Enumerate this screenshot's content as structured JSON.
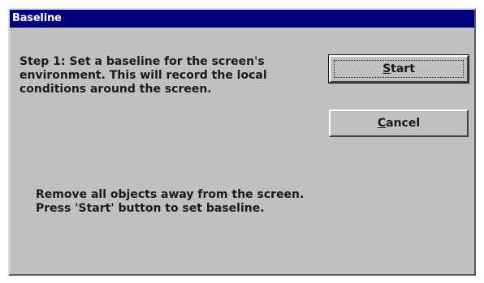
{
  "window": {
    "title": "Baseline"
  },
  "step": {
    "text": "Step 1:  Set a baseline for the screen's\nenvironment.  This will record the local\nconditions around the screen."
  },
  "buttons": {
    "start": {
      "mnemonic": "S",
      "rest": "tart"
    },
    "cancel": {
      "mnemonic": "C",
      "rest": "ancel"
    }
  },
  "instruction": {
    "text": "Remove all objects away from the screen.\nPress 'Start' button to set baseline."
  }
}
